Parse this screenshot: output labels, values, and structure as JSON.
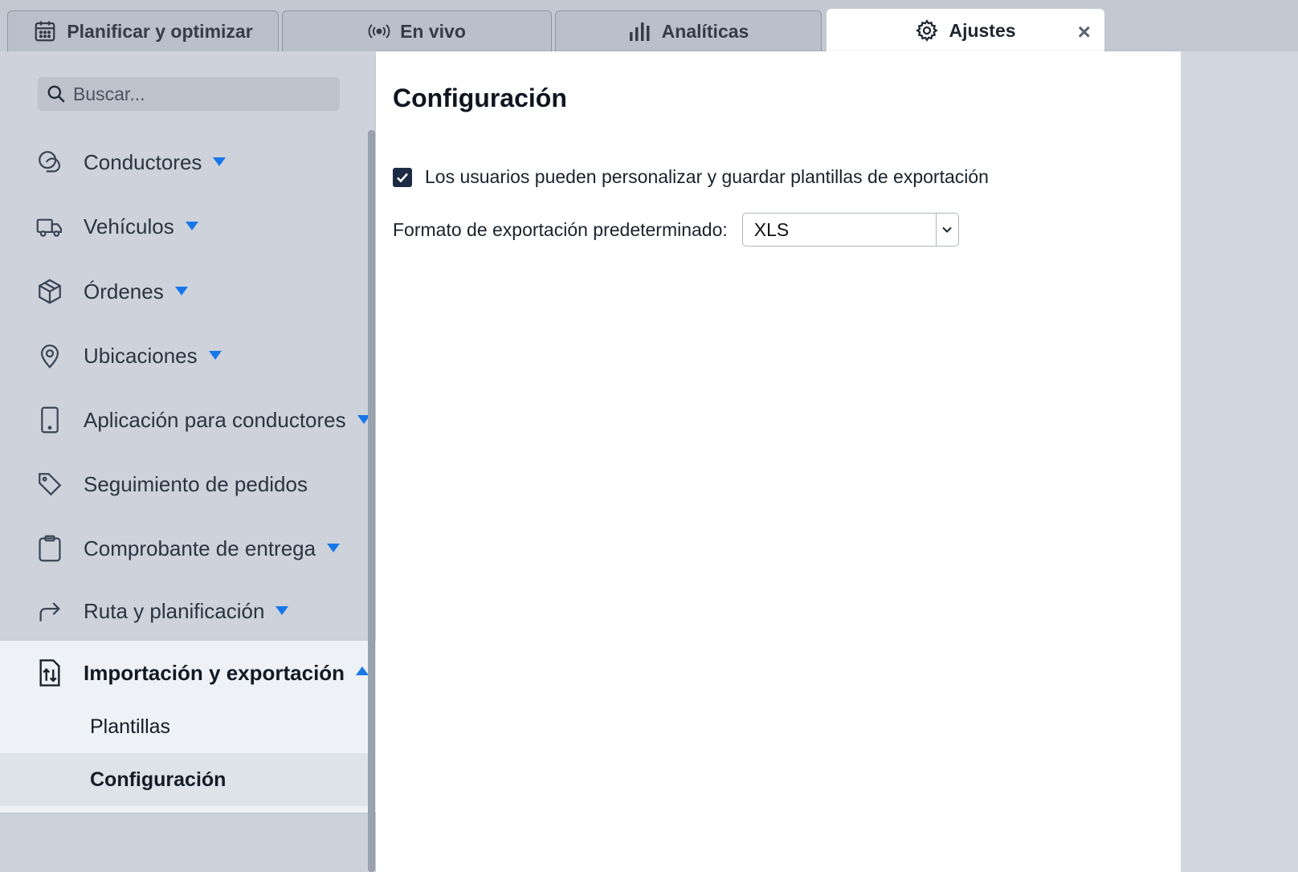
{
  "tabs": [
    {
      "label": "Planificar y optimizar",
      "icon": "calendar-icon"
    },
    {
      "label": "En vivo",
      "icon": "broadcast-icon"
    },
    {
      "label": "Analíticas",
      "icon": "bar-chart-icon"
    },
    {
      "label": "Ajustes",
      "icon": "gear-icon",
      "active": true,
      "close": "×"
    }
  ],
  "search": {
    "placeholder": "Buscar..."
  },
  "sidebar": {
    "items": [
      {
        "label": "Conductores",
        "icon": "driver-icon"
      },
      {
        "label": "Vehículos",
        "icon": "truck-icon"
      },
      {
        "label": "Órdenes",
        "icon": "package-icon"
      },
      {
        "label": "Ubicaciones",
        "icon": "map-pin-icon"
      },
      {
        "label": "Aplicación para conductores",
        "icon": "phone-icon"
      },
      {
        "label": "Seguimiento de pedidos",
        "icon": "tag-icon"
      },
      {
        "label": "Comprobante de entrega",
        "icon": "clipboard-icon"
      },
      {
        "label": "Ruta y planificación",
        "icon": "route-arrow-icon"
      }
    ],
    "expanded": {
      "label": "Importación y exportación",
      "icon": "import-export-icon",
      "subitems": [
        "Plantillas",
        "Configuración"
      ],
      "selected": "Configuración"
    }
  },
  "main": {
    "title": "Configuración",
    "checkbox_label": "Los usuarios pueden personalizar y guardar plantillas de exportación",
    "checkbox_checked": true,
    "format_label": "Formato de exportación predeterminado:",
    "format_value": "XLS"
  },
  "colors": {
    "accent": "#1877e8",
    "checkbox": "#1d2c44"
  }
}
